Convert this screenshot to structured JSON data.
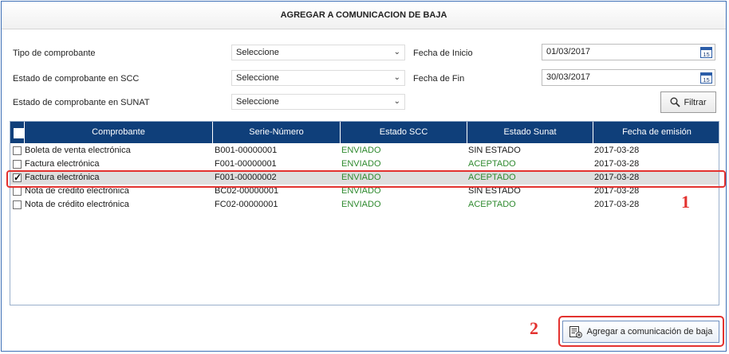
{
  "window": {
    "title": "AGREGAR A COMUNICACION DE BAJA"
  },
  "filters": {
    "tipo_label": "Tipo de comprobante",
    "tipo_value": "Seleccione",
    "estado_scc_label": "Estado de comprobante en SCC",
    "estado_scc_value": "Seleccione",
    "estado_sunat_label": "Estado de comprobante en SUNAT",
    "estado_sunat_value": "Seleccione",
    "fecha_inicio_label": "Fecha de Inicio",
    "fecha_inicio_value": "01/03/2017",
    "fecha_fin_label": "Fecha de Fin",
    "fecha_fin_value": "30/03/2017",
    "calendar_day": "15",
    "filter_button": "Filtrar"
  },
  "table": {
    "columns": [
      "Comprobante",
      "Serie-Número",
      "Estado SCC",
      "Estado Sunat",
      "Fecha de emisión"
    ],
    "rows": [
      {
        "checked": false,
        "comprobante": "Boleta de venta electrónica",
        "serie": "B001-00000001",
        "estado_scc": "ENVIADO",
        "estado_sunat": "SIN ESTADO",
        "fecha": "2017-03-28"
      },
      {
        "checked": false,
        "comprobante": "Factura electrónica",
        "serie": "F001-00000001",
        "estado_scc": "ENVIADO",
        "estado_sunat": "ACEPTADO",
        "fecha": "2017-03-28"
      },
      {
        "checked": true,
        "comprobante": "Factura electrónica",
        "serie": "F001-00000002",
        "estado_scc": "ENVIADO",
        "estado_sunat": "ACEPTADO",
        "fecha": "2017-03-28"
      },
      {
        "checked": false,
        "comprobante": "Nota de crédito electrónica",
        "serie": "BC02-00000001",
        "estado_scc": "ENVIADO",
        "estado_sunat": "SIN ESTADO",
        "fecha": "2017-03-28"
      },
      {
        "checked": false,
        "comprobante": "Nota de crédito electrónica",
        "serie": "FC02-00000001",
        "estado_scc": "ENVIADO",
        "estado_sunat": "ACEPTADO",
        "fecha": "2017-03-28"
      }
    ]
  },
  "annotations": {
    "step1": "1",
    "step2": "2"
  },
  "footer": {
    "add_button": "Agregar a comunicación de baja"
  },
  "colors": {
    "header_bg": "#0f3f7a",
    "status_green": "#2f8a2f",
    "annotation_red": "#e3322f"
  },
  "icons": {
    "calendar": "calendar-icon",
    "search": "search-icon",
    "chevron": "chevron-down-icon",
    "list": "list-icon"
  }
}
